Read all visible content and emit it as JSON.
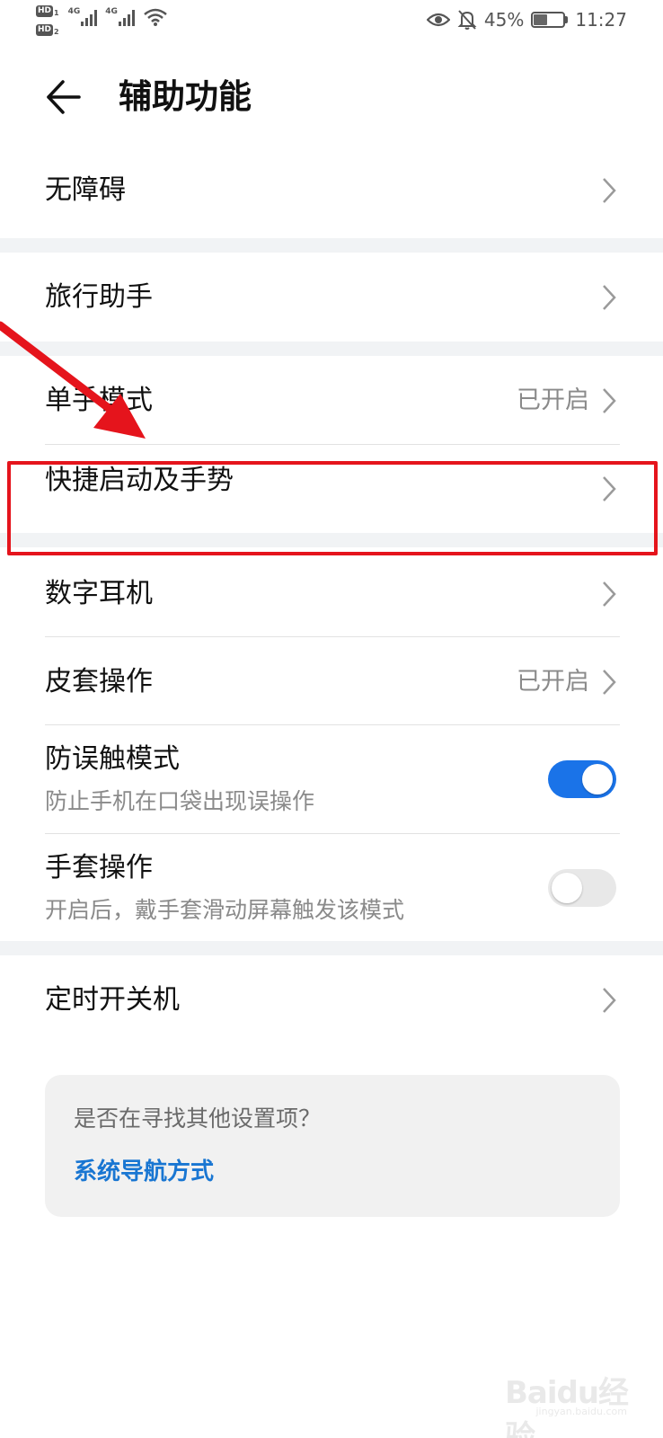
{
  "status_bar": {
    "hd1": "HD",
    "hd1_sub": "1",
    "hd2": "HD",
    "hd2_sub": "2",
    "sim1_net": "4G",
    "sim2_net": "4G",
    "battery_percent": "45%",
    "battery_level": 0.45,
    "time": "11:27",
    "icons": [
      "eye-comfort-icon",
      "mute-bell-icon",
      "battery-icon",
      "wifi-icon",
      "signal-icon"
    ]
  },
  "header": {
    "title": "辅助功能",
    "back_icon": "back-arrow-icon"
  },
  "items": {
    "accessibility": {
      "label": "无障碍"
    },
    "travel_assistant": {
      "label": "旅行助手"
    },
    "one_hand_mode": {
      "label": "单手模式",
      "value": "已开启"
    },
    "shortcuts_gestures": {
      "label": "快捷启动及手势"
    },
    "digital_earphone": {
      "label": "数字耳机"
    },
    "cover_operation": {
      "label": "皮套操作",
      "value": "已开启"
    },
    "pocket_mode": {
      "label": "防误触模式",
      "sub": "防止手机在口袋出现误操作",
      "enabled": true
    },
    "glove_mode": {
      "label": "手套操作",
      "sub": "开启后，戴手套滑动屏幕触发该模式",
      "enabled": false
    },
    "scheduled_power": {
      "label": "定时开关机"
    }
  },
  "suggestion": {
    "question": "是否在寻找其他设置项？",
    "link": "系统导航方式"
  },
  "annotation": {
    "highlight_color": "#e5141c",
    "arrow_color": "#e5141c"
  },
  "watermark": {
    "brand": "Baidu经验",
    "domain": "jingyan.baidu.com"
  },
  "colors": {
    "accent": "#1a73e8",
    "link": "#1976d2",
    "section_gap": "#f1f3f5"
  }
}
